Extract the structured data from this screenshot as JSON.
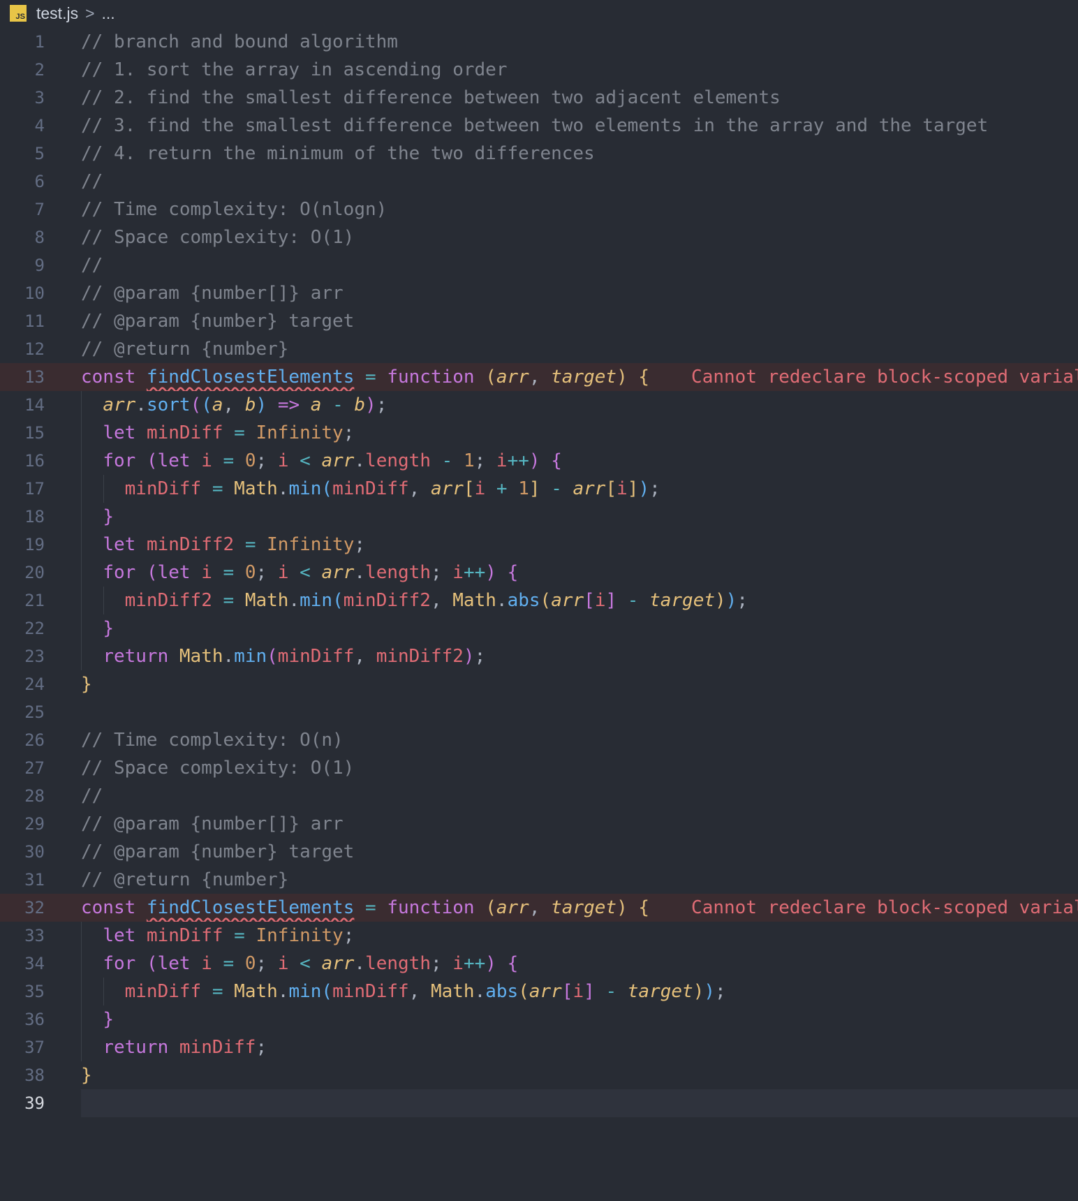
{
  "breadcrumb": {
    "file_icon": "JS",
    "file_name": "test.js",
    "separator": ">",
    "ellipsis": "..."
  },
  "editor": {
    "current_line": 39,
    "error_message": "Cannot redeclare block-scoped varial",
    "lines": [
      {
        "n": "1",
        "text": "// branch and bound algorithm"
      },
      {
        "n": "2",
        "text": "// 1. sort the array in ascending order"
      },
      {
        "n": "3",
        "text": "// 2. find the smallest difference between two adjacent elements"
      },
      {
        "n": "4",
        "text": "// 3. find the smallest difference between two elements in the array and the target"
      },
      {
        "n": "5",
        "text": "// 4. return the minimum of the two differences"
      },
      {
        "n": "6",
        "text": "//"
      },
      {
        "n": "7",
        "text": "// Time complexity: O(nlogn)"
      },
      {
        "n": "8",
        "text": "// Space complexity: O(1)"
      },
      {
        "n": "9",
        "text": "//"
      },
      {
        "n": "10",
        "text": "// @param {number[]} arr"
      },
      {
        "n": "11",
        "text": "// @param {number} target"
      },
      {
        "n": "12",
        "text": "// @return {number}"
      },
      {
        "n": "13",
        "text": "const findClosestElements = function (arr, target) {"
      },
      {
        "n": "14",
        "text": "  arr.sort((a, b) => a - b);"
      },
      {
        "n": "15",
        "text": "  let minDiff = Infinity;"
      },
      {
        "n": "16",
        "text": "  for (let i = 0; i < arr.length - 1; i++) {"
      },
      {
        "n": "17",
        "text": "    minDiff = Math.min(minDiff, arr[i + 1] - arr[i]);"
      },
      {
        "n": "18",
        "text": "  }"
      },
      {
        "n": "19",
        "text": "  let minDiff2 = Infinity;"
      },
      {
        "n": "20",
        "text": "  for (let i = 0; i < arr.length; i++) {"
      },
      {
        "n": "21",
        "text": "    minDiff2 = Math.min(minDiff2, Math.abs(arr[i] - target));"
      },
      {
        "n": "22",
        "text": "  }"
      },
      {
        "n": "23",
        "text": "  return Math.min(minDiff, minDiff2);"
      },
      {
        "n": "24",
        "text": "}"
      },
      {
        "n": "25",
        "text": ""
      },
      {
        "n": "26",
        "text": "// Time complexity: O(n)"
      },
      {
        "n": "27",
        "text": "// Space complexity: O(1)"
      },
      {
        "n": "28",
        "text": "//"
      },
      {
        "n": "29",
        "text": "// @param {number[]} arr"
      },
      {
        "n": "30",
        "text": "// @param {number} target"
      },
      {
        "n": "31",
        "text": "// @return {number}"
      },
      {
        "n": "32",
        "text": "const findClosestElements = function (arr, target) {"
      },
      {
        "n": "33",
        "text": "  let minDiff = Infinity;"
      },
      {
        "n": "34",
        "text": "  for (let i = 0; i < arr.length; i++) {"
      },
      {
        "n": "35",
        "text": "    minDiff = Math.min(minDiff, Math.abs(arr[i] - target));"
      },
      {
        "n": "36",
        "text": "  }"
      },
      {
        "n": "37",
        "text": "  return minDiff;"
      },
      {
        "n": "38",
        "text": "}"
      },
      {
        "n": "39",
        "text": ""
      }
    ]
  },
  "colors": {
    "background": "#282c34",
    "comment": "#7f848e",
    "keyword": "#c678dd",
    "function": "#61afef",
    "variable": "#e06c75",
    "class": "#e5c07b",
    "number": "#d19a66",
    "operator": "#56b6c2",
    "error": "#e06c75"
  }
}
